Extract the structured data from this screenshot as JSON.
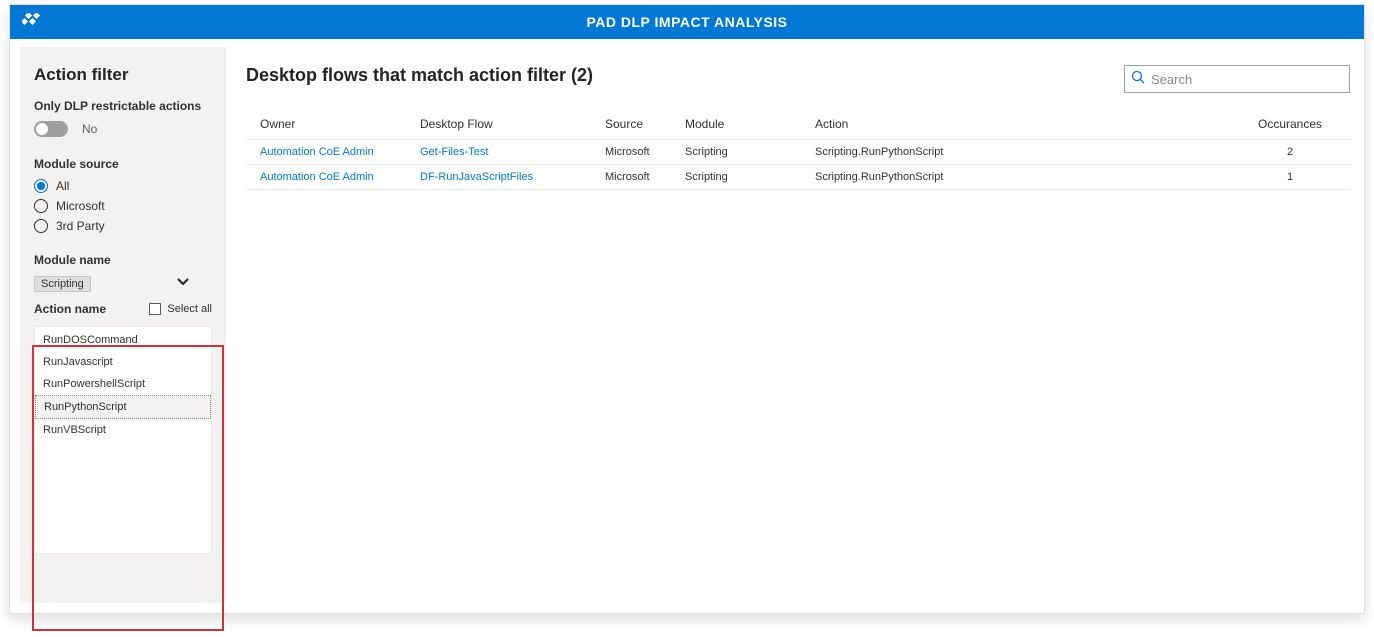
{
  "header": {
    "title": "PAD DLP IMPACT ANALYSIS"
  },
  "sidebar": {
    "title": "Action filter",
    "dlp_label": "Only DLP restrictable actions",
    "dlp_value": "No",
    "module_source_label": "Module source",
    "module_source_options": [
      "All",
      "Microsoft",
      "3rd Party"
    ],
    "module_source_selected": "All",
    "module_name_label": "Module name",
    "module_name_selected": "Scripting",
    "action_name_label": "Action name",
    "select_all_label": "Select all",
    "action_items": [
      {
        "label": "RunDOSCommand",
        "selected": false
      },
      {
        "label": "RunJavascript",
        "selected": false
      },
      {
        "label": "RunPowershellScript",
        "selected": false
      },
      {
        "label": "RunPythonScript",
        "selected": true
      },
      {
        "label": "RunVBScript",
        "selected": false
      }
    ]
  },
  "main": {
    "title": "Desktop flows that match action filter (2)",
    "search_placeholder": "Search",
    "columns": [
      "Owner",
      "Desktop Flow",
      "Source",
      "Module",
      "Action",
      "Occurances"
    ],
    "rows": [
      {
        "owner": "Automation CoE Admin",
        "flow": "Get-Files-Test",
        "source": "Microsoft",
        "module": "Scripting",
        "action": "Scripting.RunPythonScript",
        "occ": "2"
      },
      {
        "owner": "Automation CoE Admin",
        "flow": "DF-RunJavaScriptFiles",
        "source": "Microsoft",
        "module": "Scripting",
        "action": "Scripting.RunPythonScript",
        "occ": "1"
      }
    ]
  }
}
